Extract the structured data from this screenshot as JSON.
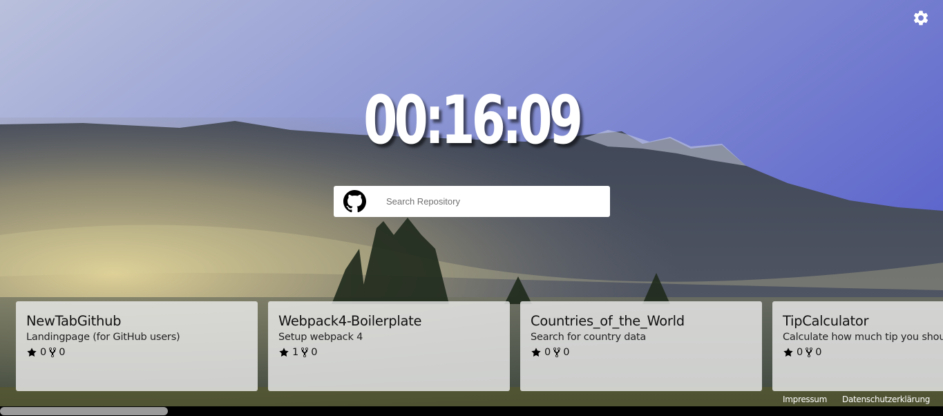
{
  "clock": {
    "time": "00:16:09"
  },
  "search": {
    "placeholder": "Search Repository"
  },
  "cards": [
    {
      "title": "NewTabGithub",
      "description": "Landingpage (for GitHub users)",
      "stars": "0",
      "forks": "0"
    },
    {
      "title": "Webpack4-Boilerplate",
      "description": "Setup webpack 4",
      "stars": "1",
      "forks": "0"
    },
    {
      "title": "Countries_of_the_World",
      "description": "Search for country data",
      "stars": "0",
      "forks": "0"
    },
    {
      "title": "TipCalculator",
      "description": "Calculate how much tip you should give",
      "stars": "0",
      "forks": "0"
    }
  ],
  "footer": {
    "impressum": "Impressum",
    "privacy": "Datenschutzerklärung"
  },
  "icons": {
    "settings": "gear-icon",
    "github": "github-icon",
    "star": "star-icon",
    "fork": "fork-icon"
  },
  "colors": {
    "card_background": "#ebebeb",
    "scrollbar_track": "#000000",
    "scrollbar_thumb": "#9a9a9a",
    "clock_text": "#ffffff"
  }
}
